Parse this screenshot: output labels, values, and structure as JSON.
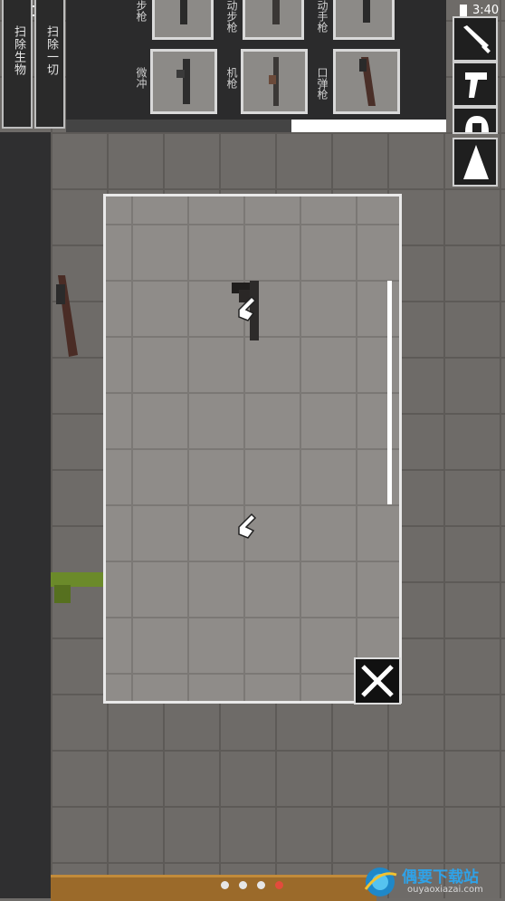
{
  "status_bar": {
    "time": "3:40"
  },
  "side_buttons": [
    {
      "label": "扫除生物"
    },
    {
      "label": "扫除一切"
    }
  ],
  "categories": {
    "top_row": [
      "步枪",
      "动步枪",
      "动手枪"
    ],
    "bottom_row": [
      "微冲",
      "机枪",
      "口弹枪"
    ]
  },
  "toolbar_icons": [
    "sword-icon",
    "pistol-icon",
    "helmet-icon",
    "spawn-triangle-icon"
  ],
  "page_indicator": {
    "total": 4,
    "active": 4,
    "active_color": "#e34b3c"
  },
  "watermark": {
    "name": "偶要下载站",
    "url": "ouyaoxiazai.com"
  }
}
